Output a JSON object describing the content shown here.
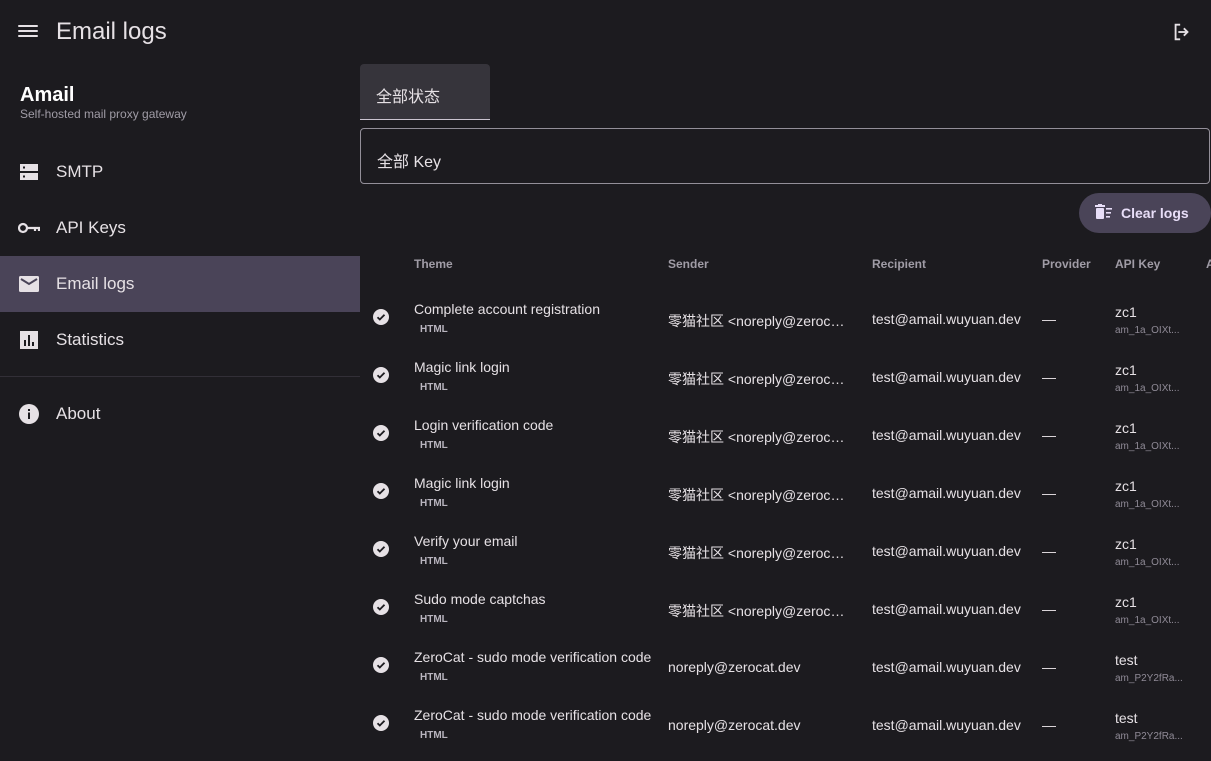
{
  "header": {
    "title": "Email logs"
  },
  "sidebar": {
    "brand": "Amail",
    "tagline": "Self-hosted mail proxy gateway",
    "items": [
      {
        "label": "SMTP",
        "icon": "dns-icon"
      },
      {
        "label": "API Keys",
        "icon": "key-icon"
      },
      {
        "label": "Email logs",
        "icon": "mail-icon",
        "active": true
      },
      {
        "label": "Statistics",
        "icon": "chart-icon"
      }
    ],
    "about": "About"
  },
  "filters": {
    "status": "全部状态",
    "key": "全部 Key"
  },
  "actions": {
    "clear_logs": "Clear logs"
  },
  "table": {
    "columns": [
      "Theme",
      "Sender",
      "Recipient",
      "Provider",
      "API Key",
      "A"
    ],
    "rows": [
      {
        "theme": "Complete account registration",
        "format": "HTML",
        "sender": "零猫社区 <noreply@zerocat.dev>",
        "recipient": "test@amail.wuyuan.dev",
        "provider": "—",
        "key_name": "zc1",
        "key_id": "am_1a_OIXt..."
      },
      {
        "theme": "Magic link login",
        "format": "HTML",
        "sender": "零猫社区 <noreply@zerocat.dev>",
        "recipient": "test@amail.wuyuan.dev",
        "provider": "—",
        "key_name": "zc1",
        "key_id": "am_1a_OIXt..."
      },
      {
        "theme": "Login verification code",
        "format": "HTML",
        "sender": "零猫社区 <noreply@zerocat.dev>",
        "recipient": "test@amail.wuyuan.dev",
        "provider": "—",
        "key_name": "zc1",
        "key_id": "am_1a_OIXt..."
      },
      {
        "theme": "Magic link login",
        "format": "HTML",
        "sender": "零猫社区 <noreply@zerocat.dev>",
        "recipient": "test@amail.wuyuan.dev",
        "provider": "—",
        "key_name": "zc1",
        "key_id": "am_1a_OIXt..."
      },
      {
        "theme": "Verify your email",
        "format": "HTML",
        "sender": "零猫社区 <noreply@zerocat.dev>",
        "recipient": "test@amail.wuyuan.dev",
        "provider": "—",
        "key_name": "zc1",
        "key_id": "am_1a_OIXt..."
      },
      {
        "theme": "Sudo mode captchas",
        "format": "HTML",
        "sender": "零猫社区 <noreply@zerocat.dev>",
        "recipient": "test@amail.wuyuan.dev",
        "provider": "—",
        "key_name": "zc1",
        "key_id": "am_1a_OIXt..."
      },
      {
        "theme": "ZeroCat - sudo mode verification code",
        "format": "HTML",
        "sender": "noreply@zerocat.dev",
        "recipient": "test@amail.wuyuan.dev",
        "provider": "—",
        "key_name": "test",
        "key_id": "am_P2Y2fRa..."
      },
      {
        "theme": "ZeroCat - sudo mode verification code",
        "format": "HTML",
        "sender": "noreply@zerocat.dev",
        "recipient": "test@amail.wuyuan.dev",
        "provider": "—",
        "key_name": "test",
        "key_id": "am_P2Y2fRa..."
      }
    ]
  },
  "colors": {
    "background": "#1c1b1f",
    "active_nav": "#4a4458",
    "button": "#4a4458"
  }
}
